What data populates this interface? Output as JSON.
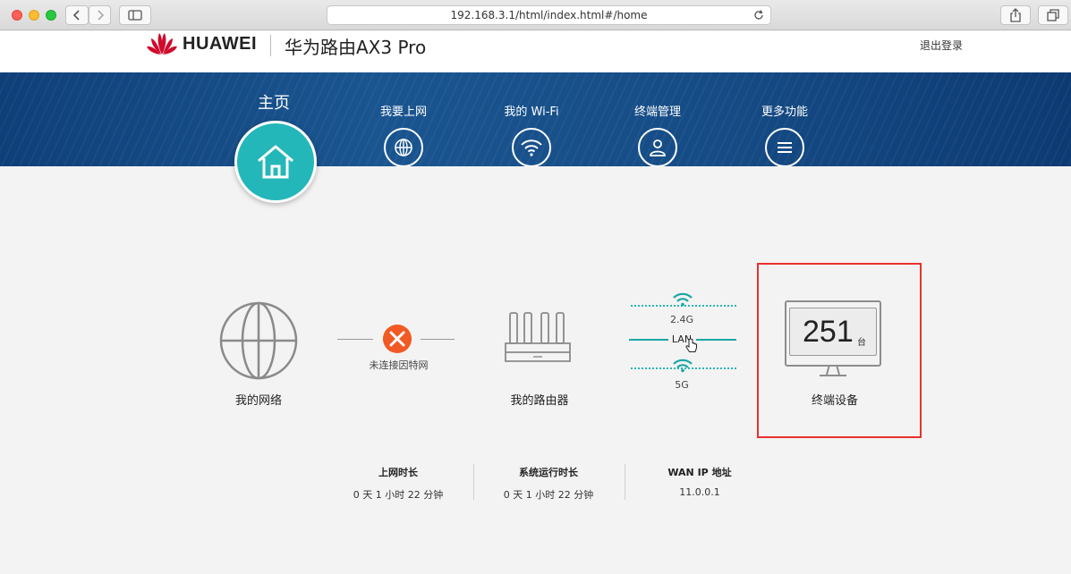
{
  "browser": {
    "url": "192.168.3.1/html/index.html#/home"
  },
  "header": {
    "brand": "HUAWEI",
    "product": "华为路由AX3 Pro",
    "logout": "退出登录"
  },
  "nav": {
    "home": "主页",
    "items": [
      {
        "label": "我要上网",
        "icon": "globe-icon"
      },
      {
        "label": "我的 Wi-Fi",
        "icon": "wifi-icon"
      },
      {
        "label": "终端管理",
        "icon": "user-icon"
      },
      {
        "label": "更多功能",
        "icon": "menu-icon"
      }
    ]
  },
  "topology": {
    "network_label": "我的网络",
    "connection_status": "未连接因特网",
    "router_label": "我的路由器",
    "band_24": "2.4G",
    "lan": "LAN",
    "band_5": "5G",
    "device_count": "251",
    "device_unit": "台",
    "devices_label": "终端设备"
  },
  "stats": [
    {
      "title": "上网时长",
      "value": "0 天 1 小时 22 分钟"
    },
    {
      "title": "系统运行时长",
      "value": "0 天 1 小时 22 分钟"
    },
    {
      "title": "WAN IP 地址",
      "value": "11.0.0.1"
    }
  ],
  "colors": {
    "nav_blue": "#164c86",
    "teal": "#24b7b9",
    "error_orange": "#f15a24",
    "highlight_red": "#e8312e",
    "huawei_red": "#cf0a2c"
  }
}
